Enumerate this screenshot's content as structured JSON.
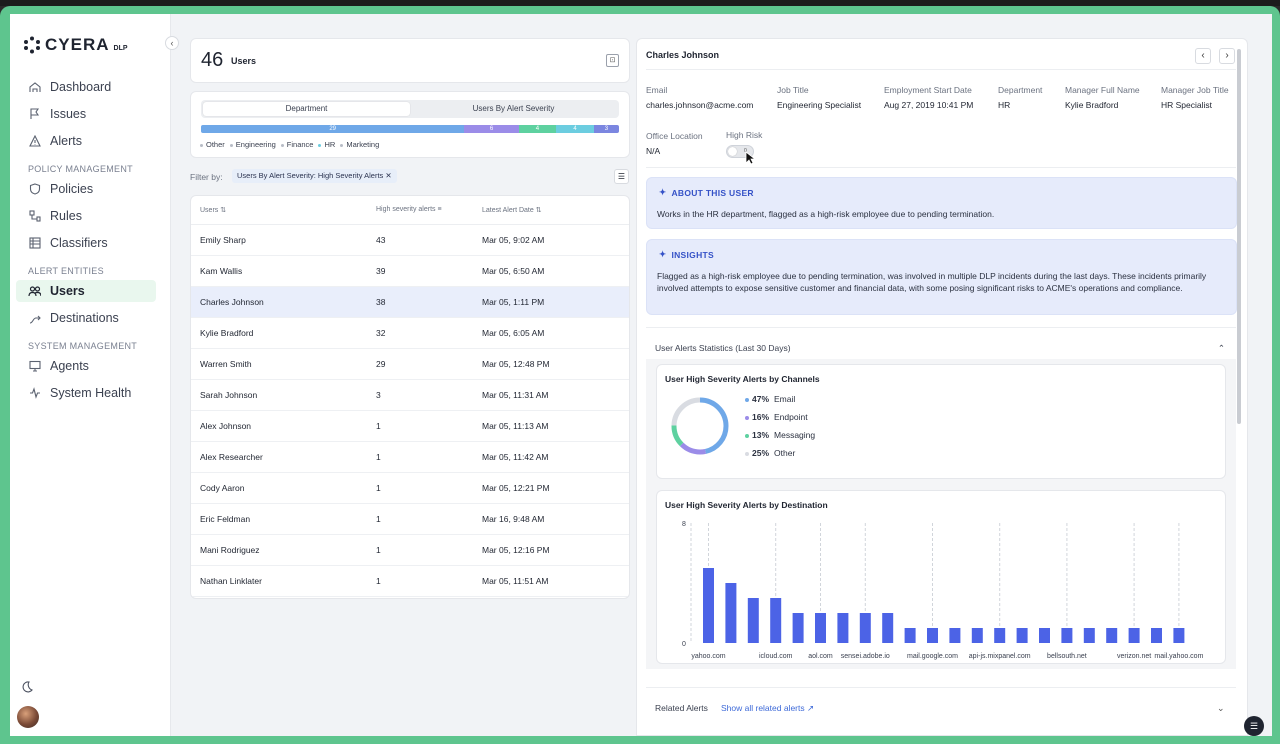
{
  "app": {
    "brand": "CYERA",
    "brand_sub": "DLP"
  },
  "sidebar": {
    "items": [
      {
        "label": "Dashboard",
        "icon": "dashboard-icon"
      },
      {
        "label": "Issues",
        "icon": "flag-icon"
      },
      {
        "label": "Alerts",
        "icon": "alert-triangle-icon"
      },
      {
        "label": "Policies",
        "icon": "shield-icon"
      },
      {
        "label": "Rules",
        "icon": "rules-icon"
      },
      {
        "label": "Classifiers",
        "icon": "classifier-icon"
      },
      {
        "label": "Users",
        "icon": "users-icon",
        "active": true
      },
      {
        "label": "Destinations",
        "icon": "route-icon"
      },
      {
        "label": "Agents",
        "icon": "monitor-icon"
      },
      {
        "label": "System Health",
        "icon": "pulse-icon"
      }
    ],
    "sections": [
      "POLICY MANAGEMENT",
      "ALERT ENTITIES",
      "SYSTEM MANAGEMENT"
    ]
  },
  "users_panel": {
    "count": "46",
    "count_label": "Users",
    "tabs": [
      "Department",
      "Users By Alert Severity"
    ],
    "bar": [
      {
        "label": "29",
        "color": "#6fa8e8",
        "frac": 0.63
      },
      {
        "label": "6",
        "color": "#9b8ce8",
        "frac": 0.13
      },
      {
        "label": "4",
        "color": "#5ed1a0",
        "frac": 0.09
      },
      {
        "label": "4",
        "color": "#6ccde0",
        "frac": 0.09
      },
      {
        "label": "3",
        "color": "#7b86e0",
        "frac": 0.06
      }
    ],
    "legend": [
      {
        "label": "Other",
        "color": "#b7bcc6"
      },
      {
        "label": "Engineering",
        "color": "#b7bcc6"
      },
      {
        "label": "Finance",
        "color": "#b7bcc6"
      },
      {
        "label": "HR",
        "color": "#6ccde0"
      },
      {
        "label": "Marketing",
        "color": "#b7bcc6"
      }
    ],
    "filter_label": "Filter by:",
    "filter_chip": "Users By Alert Severity: High Severity Alerts",
    "columns": [
      "Users",
      "High severity alerts",
      "Latest Alert Date"
    ],
    "rows": [
      [
        "Emily Sharp",
        "43",
        "Mar 05, 9:02 AM"
      ],
      [
        "Kam Wallis",
        "39",
        "Mar 05, 6:50 AM"
      ],
      [
        "Charles Johnson",
        "38",
        "Mar 05, 1:11 PM"
      ],
      [
        "Kylie Bradford",
        "32",
        "Mar 05, 6:05 AM"
      ],
      [
        "Warren Smith",
        "29",
        "Mar 05, 12:48 PM"
      ],
      [
        "Sarah Johnson",
        "3",
        "Mar 05, 11:31 AM"
      ],
      [
        "Alex Johnson",
        "1",
        "Mar 05, 11:13 AM"
      ],
      [
        "Alex Researcher",
        "1",
        "Mar 05, 11:42 AM"
      ],
      [
        "Cody Aaron",
        "1",
        "Mar 05, 12:21 PM"
      ],
      [
        "Eric Feldman",
        "1",
        "Mar 16, 9:48 AM"
      ],
      [
        "Mani Rodriguez",
        "1",
        "Mar 05, 12:16 PM"
      ],
      [
        "Nathan Linklater",
        "1",
        "Mar 05, 11:51 AM"
      ]
    ],
    "selected_row": 2
  },
  "detail": {
    "name": "Charles Johnson",
    "fields": [
      {
        "k": "Email",
        "v": "charles.johnson@acme.com"
      },
      {
        "k": "Job Title",
        "v": "Engineering Specialist"
      },
      {
        "k": "Employment Start Date",
        "v": "Aug 27, 2019 10:41 PM"
      },
      {
        "k": "Department",
        "v": "HR"
      },
      {
        "k": "Manager Full Name",
        "v": "Kylie Bradford"
      },
      {
        "k": "Manager Job Title",
        "v": "HR Specialist"
      },
      {
        "k": "Office Location",
        "v": "N/A"
      },
      {
        "k": "High Risk",
        "v": ""
      }
    ],
    "toggle_text": "0",
    "about_title": "ABOUT THIS USER",
    "about_text": "Works in the HR department, flagged as a high-risk employee due to pending termination.",
    "insights_title": "INSIGHTS",
    "insights_text": "Flagged as a high-risk employee due to pending termination, was involved in multiple DLP incidents during the last days. These incidents primarily involved attempts to expose sensitive customer and financial data, with some posing significant risks to ACME's operations and compliance.",
    "stats_title": "User Alerts Statistics (Last 30 Days)",
    "related_label": "Related Alerts",
    "related_link": "Show all related alerts"
  },
  "chart_data": [
    {
      "type": "pie",
      "title": "User High Severity Alerts by Channels",
      "slices": [
        {
          "label": "Email",
          "value": 47,
          "pct_label": "47%",
          "color": "#6fa8e8"
        },
        {
          "label": "Endpoint",
          "value": 16,
          "pct_label": "16%",
          "color": "#9b8ce8"
        },
        {
          "label": "Messaging",
          "value": 13,
          "pct_label": "13%",
          "color": "#5ed1a0"
        },
        {
          "label": "Other",
          "value": 25,
          "pct_label": "25%",
          "color": "#d9dce2"
        }
      ]
    },
    {
      "type": "bar",
      "title": "User High Severity Alerts by Destination",
      "ylim": [
        0,
        8
      ],
      "yticks": [
        "8",
        "0"
      ],
      "values": [
        5,
        4,
        3,
        3,
        2,
        2,
        2,
        2,
        2,
        1,
        1,
        1,
        1,
        1,
        1,
        1,
        1,
        1,
        1,
        1,
        1,
        1
      ],
      "x_tick_labels": [
        {
          "index": 0,
          "label": "yahoo.com"
        },
        {
          "index": 3,
          "label": "icloud.com"
        },
        {
          "index": 5,
          "label": "aol.com"
        },
        {
          "index": 7,
          "label": "sensei.adobe.io"
        },
        {
          "index": 10,
          "label": "mail.google.com"
        },
        {
          "index": 13,
          "label": "api-js.mixpanel.com"
        },
        {
          "index": 16,
          "label": "bellsouth.net"
        },
        {
          "index": 19,
          "label": "verizon.net"
        },
        {
          "index": 21,
          "label": "mail.yahoo.com"
        }
      ],
      "bar_color": "#4c63e6"
    }
  ]
}
